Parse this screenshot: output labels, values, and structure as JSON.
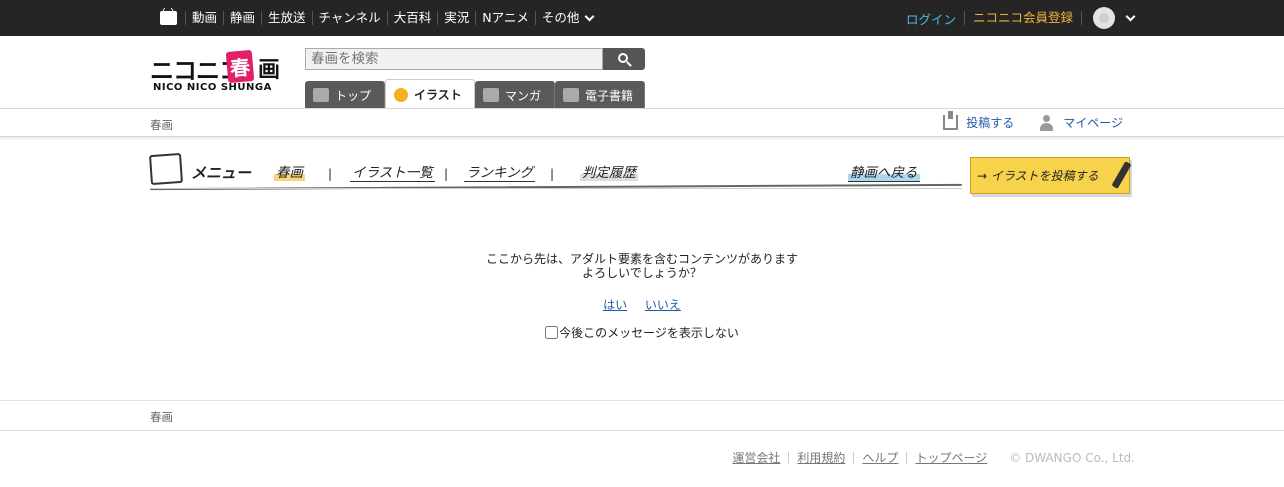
{
  "global_nav": {
    "items": [
      "動画",
      "静画",
      "生放送",
      "チャンネル",
      "大百科",
      "実況",
      "Nアニメ"
    ],
    "more_label": "その他",
    "login_label": "ログイン",
    "register_label": "ニコニコ会員登録"
  },
  "logo": {
    "main": "ニコニコ",
    "shunga": "春",
    "ga": "画",
    "sub": "NICO NICO SHUNGA"
  },
  "search": {
    "placeholder": "春画を検索"
  },
  "tabs": [
    {
      "label": "トップ",
      "active": false
    },
    {
      "label": "イラスト",
      "active": true
    },
    {
      "label": "マンガ",
      "active": false
    },
    {
      "label": "電子書籍",
      "active": false
    }
  ],
  "subbar": {
    "breadcrumb": "春画",
    "post_label": "投稿する",
    "mypage_label": "マイページ"
  },
  "menu": {
    "title": "メニュー",
    "items": [
      "春画",
      "イラスト一覧",
      "ランキング",
      "判定履歴"
    ],
    "back_label": "静画へ戻る",
    "post_illust_label": "→ イラストを投稿する"
  },
  "warning": {
    "line1": "ここから先は、アダルト要素を含むコンテンツがあります",
    "line2": "よろしいでしょうか？",
    "yes_label": "はい",
    "no_label": "いいえ",
    "hide_label": "今後このメッセージを表示しない",
    "hide_checked": false
  },
  "footer": {
    "breadcrumb": "春画",
    "links": [
      "運営会社",
      "利用規約",
      "ヘルプ",
      "トップページ"
    ],
    "copyright": "© DWANGO Co., Ltd."
  },
  "colors": {
    "topbar": "#252525",
    "login": "#4fb8e8",
    "register": "#f0b23b",
    "link": "#1f5aa5",
    "logo_accent": "#e2206a",
    "post_button": "#f6d34a"
  }
}
